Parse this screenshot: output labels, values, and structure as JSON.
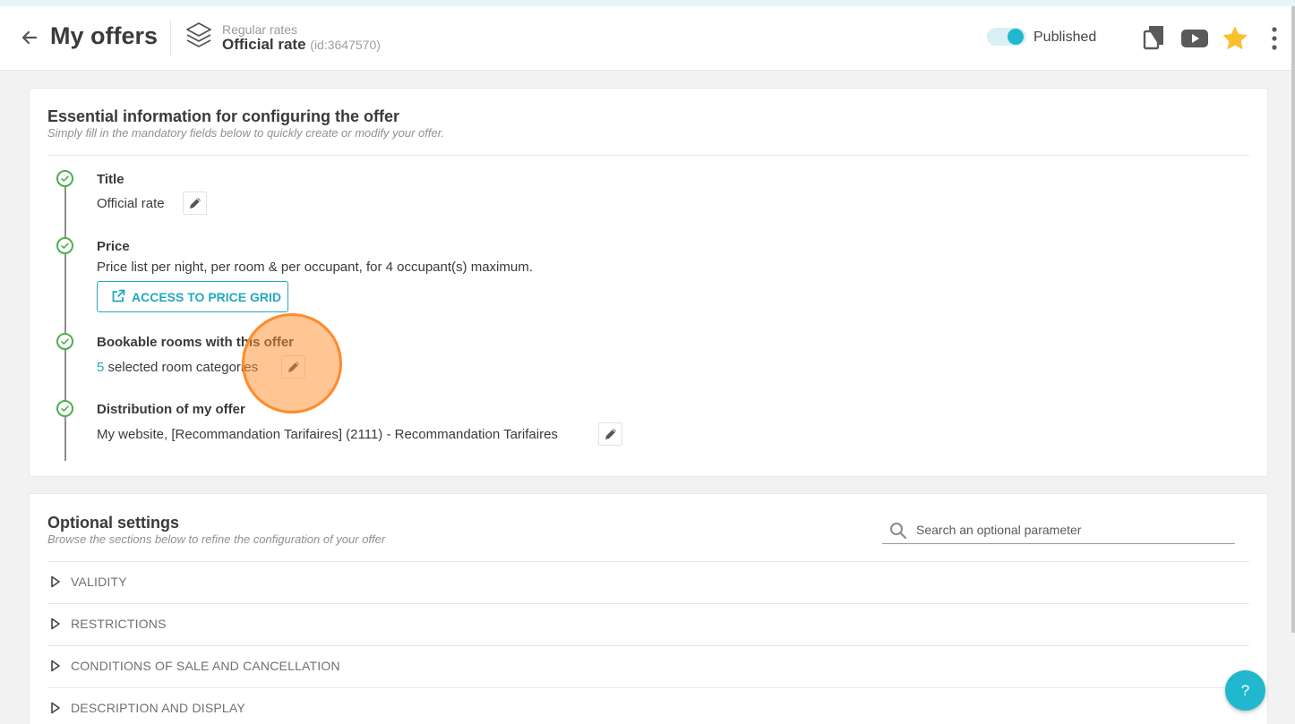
{
  "header": {
    "back_icon": "arrow-left-icon",
    "title": "My offers",
    "rate_category": "Regular rates",
    "rate_name": "Official rate",
    "rate_id": "(id:3647570)",
    "published_label": "Published",
    "published": true,
    "icons": [
      "copy-icon",
      "youtube-icon",
      "star-icon",
      "more-vertical-icon"
    ],
    "accent_color": "#21b8cf",
    "star_color": "#fbc02d"
  },
  "essential": {
    "title": "Essential information for configuring the offer",
    "subtitle": "Simply fill in the mandatory fields below to quickly create or modify your offer.",
    "steps": {
      "title": {
        "label": "Title",
        "value": "Official rate"
      },
      "price": {
        "label": "Price",
        "value": "Price list per night, per room & per occupant, for 4 occupant(s) maximum.",
        "button": "ACCESS TO PRICE GRID"
      },
      "rooms": {
        "label": "Bookable rooms with this offer",
        "count": "5",
        "value": "selected room categories"
      },
      "distribution": {
        "label": "Distribution of my offer",
        "value": "My website, [Recommandation Tarifaires] (2111) - Recommandation Tarifaires"
      }
    },
    "check_color": "#4caf50"
  },
  "optional": {
    "title": "Optional settings",
    "subtitle": "Browse the sections below to refine the configuration of your offer",
    "search_placeholder": "Search an optional parameter",
    "sections": [
      "VALIDITY",
      "RESTRICTIONS",
      "CONDITIONS OF SALE AND CANCELLATION",
      "DESCRIPTION AND DISPLAY"
    ]
  },
  "help": {
    "label": "?"
  }
}
